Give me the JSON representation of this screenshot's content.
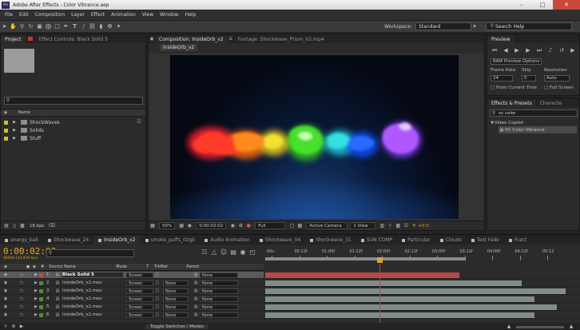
{
  "window": {
    "title": "Adobe After Effects - Color Vibrance.aep"
  },
  "menu": [
    "File",
    "Edit",
    "Composition",
    "Layer",
    "Effect",
    "Animation",
    "View",
    "Window",
    "Help"
  ],
  "toolbar": {
    "workspace_label": "Workspace:",
    "workspace_value": "Standard",
    "search_placeholder": "Search Help"
  },
  "project_panel": {
    "tab_project": "Project",
    "tab_effect_controls": "Effect Controls: Black Solid 5",
    "column_name": "Name",
    "items": [
      {
        "name": "ShockWaves"
      },
      {
        "name": "Solids"
      },
      {
        "name": "Stuff"
      }
    ],
    "bpc": "16 bpc"
  },
  "comp_panel": {
    "tab_composition": "Composition: InsideOrb_v2",
    "tab_footage": "Footage: Shockwave_Prism_V2.mp4",
    "subtab": "InsideOrb_v2",
    "zoom": "50%",
    "timecode": "0:00:02:02",
    "resolution": "Full",
    "camera": "Active Camera",
    "view": "1 View",
    "exposure": "+0.0"
  },
  "preview_panel": {
    "tab": "Preview",
    "ram_options": "RAM Preview Options",
    "frame_rate_label": "Frame Rate",
    "skip_label": "Skip",
    "resolution_label": "Resolution",
    "frame_rate_value": "24",
    "skip_value": "0",
    "resolution_value": "Auto",
    "from_current": "From Current Time",
    "full_screen": "Full Screen"
  },
  "effects_panel": {
    "tab_effects": "Effects & Presets",
    "tab_character": "Characte",
    "search_value": "vc color",
    "category": "Video Copilot",
    "effect": "VC Color Vibrance"
  },
  "timeline": {
    "tabs": [
      "energy_ball",
      "Shockwave_24",
      "InsideOrb_v2",
      "smoke_puffs_02gb",
      "Audio Animation",
      "Shockwave_04",
      "Shockwave_31",
      "SUN COMP",
      "Particular",
      "Clouds",
      "Text Fade",
      "Fract"
    ],
    "active_tab": "InsideOrb_v2",
    "timecode": "0:00:02:02",
    "fps_note": "00050 (23.976 fps)",
    "columns": {
      "source_name": "Source Name",
      "mode": "Mode",
      "t": "T",
      "trkmat": "TrkMat",
      "parent": "Parent"
    },
    "ruler_ticks": [
      "00s",
      "00:12f",
      "01:00f",
      "01:12f",
      "02:00f",
      "02:12f",
      "03:00f",
      "03:12f",
      "04:00f",
      "04:12f",
      "05:12"
    ],
    "layers": [
      {
        "num": "1",
        "name": "Black Solid 5",
        "mode": "Screen",
        "trkmat": "",
        "parent": "None",
        "label_color": "#c14b4b",
        "bar_color": "#b54848",
        "bar_end": 0.62
      },
      {
        "num": "2",
        "name": "InsideOrb_v2.mov",
        "mode": "Screen",
        "trkmat": "None",
        "parent": "None",
        "label_color": "#4f8a3c",
        "bar_color": "#7f8e8a",
        "bar_end": 0.82
      },
      {
        "num": "3",
        "name": "InsideOrb_v2.mov",
        "mode": "Screen",
        "trkmat": "None",
        "parent": "None",
        "label_color": "#4f8a3c",
        "bar_color": "#7f8e8a",
        "bar_end": 0.96
      },
      {
        "num": "4",
        "name": "InsideOrb_v2.mov",
        "mode": "Screen",
        "trkmat": "None",
        "parent": "None",
        "label_color": "#4f8a3c",
        "bar_color": "#7f8e8a",
        "bar_end": 0.86
      },
      {
        "num": "5",
        "name": "InsideOrb_v2.mov",
        "mode": "Screen",
        "trkmat": "None",
        "parent": "None",
        "label_color": "#4f8a3c",
        "bar_color": "#7f8e8a",
        "bar_end": 0.93
      },
      {
        "num": "6",
        "name": "InsideOrb_v2.mov",
        "mode": "Screen",
        "trkmat": "None",
        "parent": "None",
        "label_color": "#4f8a3c",
        "bar_color": "#7f8e8a",
        "bar_end": 0.86
      }
    ],
    "toggle_label": "Toggle Switches / Modes"
  }
}
